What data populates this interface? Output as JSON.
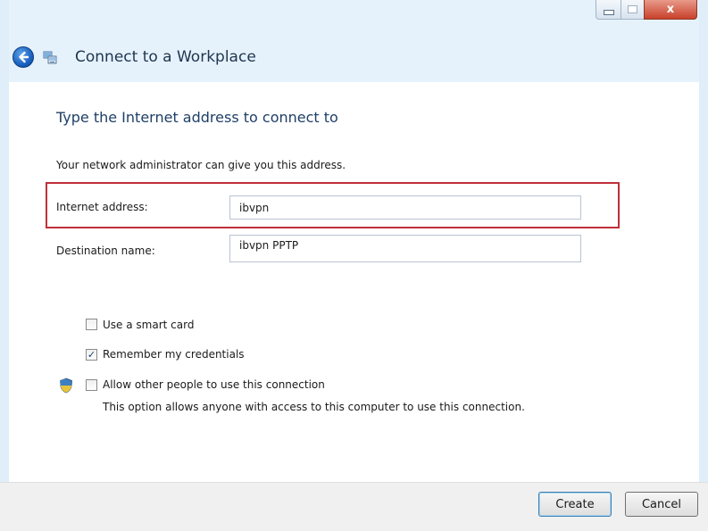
{
  "window": {
    "title": "Connect to a Workplace",
    "close_symbol": "x"
  },
  "icons": {
    "back": "back-arrow-icon",
    "app": "network-connection-icon",
    "shield": "uac-shield-icon",
    "minimize": "minimize-icon",
    "maximize": "maximize-icon",
    "close": "close-icon"
  },
  "main": {
    "heading": "Type the Internet address to connect to",
    "subtext": "Your network administrator can give you this address.",
    "internet_address": {
      "label": "Internet address:",
      "value": "ibvpn"
    },
    "destination_name": {
      "label": "Destination name:",
      "value": "ibvpn PPTP"
    },
    "options": {
      "smart_card": {
        "label": "Use a smart card",
        "checked": false
      },
      "remember": {
        "label": "Remember my credentials",
        "checked": true,
        "check_mark": "✓"
      },
      "allow_others": {
        "label": "Allow other people to use this connection",
        "checked": false,
        "description": "This option allows anyone with access to this computer to use this connection."
      }
    }
  },
  "footer": {
    "create_label": "Create",
    "cancel_label": "Cancel"
  },
  "colors": {
    "highlight_border": "#c0303a",
    "chrome_background": "#e6f2fb",
    "heading_text": "#1e3f66",
    "close_button": "#c8412b"
  }
}
